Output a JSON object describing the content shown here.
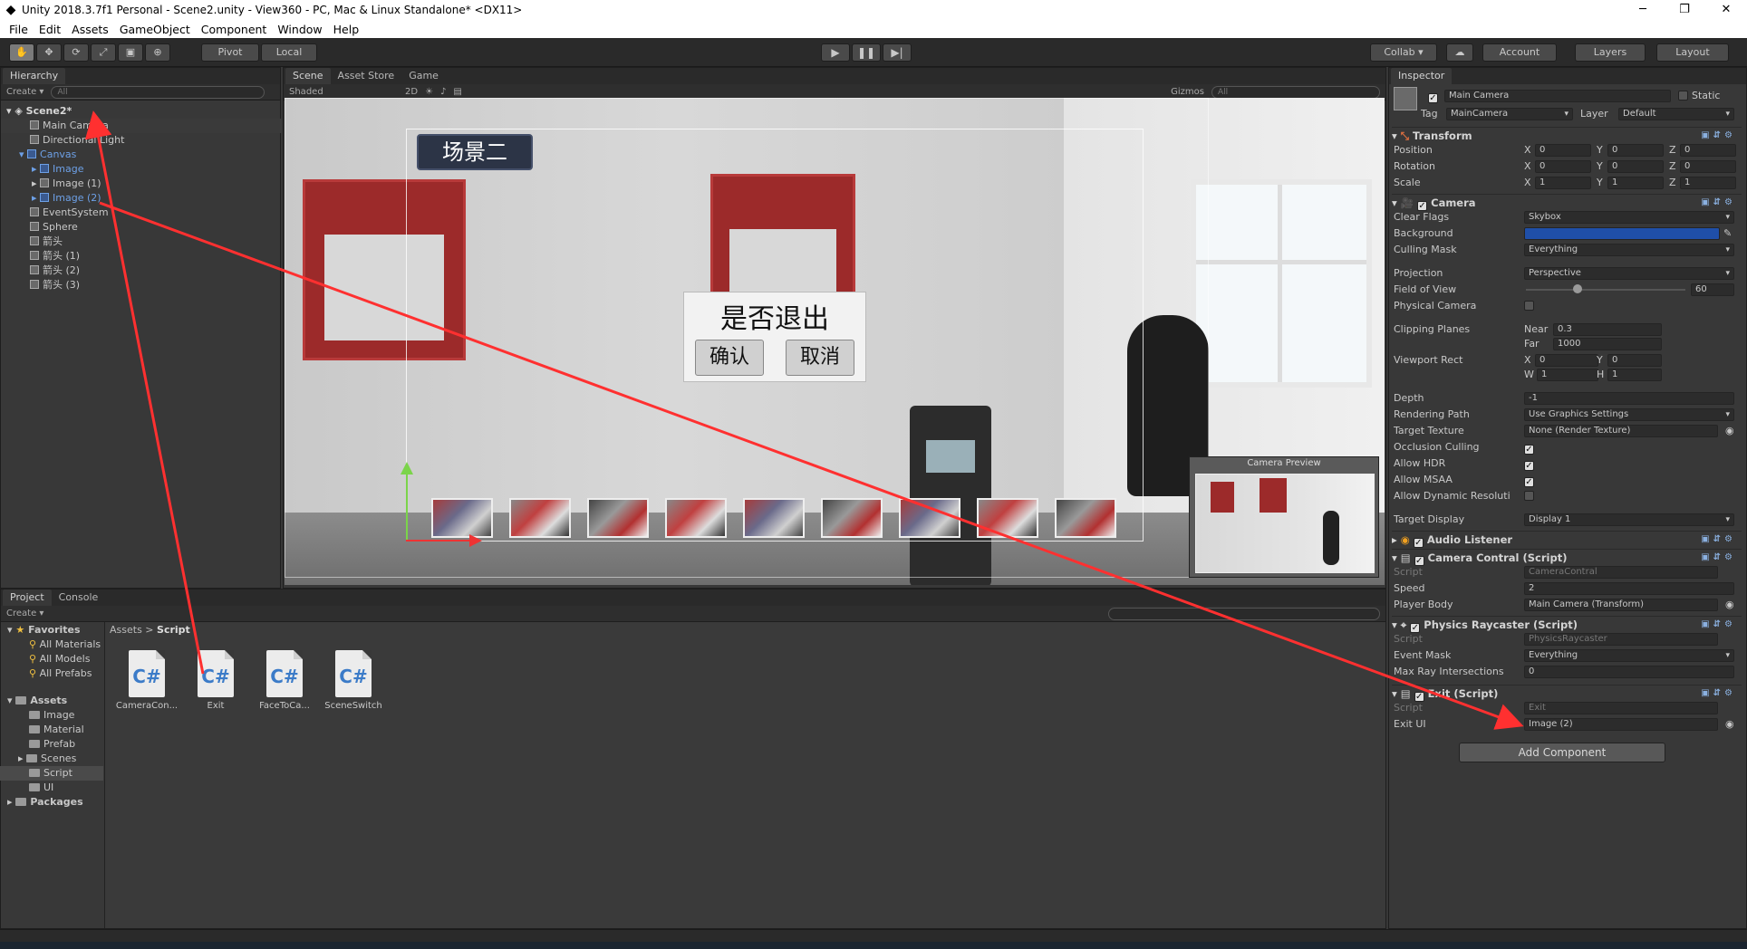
{
  "window": {
    "title": "Unity 2018.3.7f1 Personal - Scene2.unity - View360 - PC, Mac & Linux Standalone* <DX11>",
    "min": "─",
    "max": "❐",
    "close": "✕"
  },
  "menu": [
    "File",
    "Edit",
    "Assets",
    "GameObject",
    "Component",
    "Window",
    "Help"
  ],
  "toolbar": {
    "tools": [
      "✋",
      "✥",
      "⟳",
      "⤢",
      "▣",
      "⊕"
    ],
    "pivot": "Pivot",
    "local": "Local",
    "play": "▶",
    "pause": "❚❚",
    "step": "▶|",
    "collab": "Collab ▾",
    "cloud": "☁",
    "account": "Account",
    "layers": "Layers",
    "layout": "Layout"
  },
  "hierarchy": {
    "tab": "Hierarchy",
    "create": "Create ▾",
    "search": "All",
    "scene": "Scene2*",
    "items": [
      {
        "label": "Main Camera",
        "indent": 1
      },
      {
        "label": "Directional Light",
        "indent": 1
      },
      {
        "label": "Canvas",
        "indent": 1
      },
      {
        "label": "Image",
        "indent": 2
      },
      {
        "label": "Image (1)",
        "indent": 2
      },
      {
        "label": "Image (2)",
        "indent": 2
      },
      {
        "label": "EventSystem",
        "indent": 1
      },
      {
        "label": "Sphere",
        "indent": 1
      },
      {
        "label": "箭头",
        "indent": 1
      },
      {
        "label": "箭头 (1)",
        "indent": 1
      },
      {
        "label": "箭头 (2)",
        "indent": 1
      },
      {
        "label": "箭头 (3)",
        "indent": 1
      }
    ]
  },
  "scene": {
    "tabs": [
      "Scene",
      "Asset Store",
      "Game"
    ],
    "shading": "Shaded",
    "mode2d": "2D",
    "gizmos": "Gizmos",
    "search": "All",
    "title_badge": "场景二",
    "dialog": {
      "question": "是否退出",
      "confirm": "确认",
      "cancel": "取消"
    },
    "camera_preview": "Camera Preview"
  },
  "project": {
    "tabs": [
      "Project",
      "Console"
    ],
    "create": "Create ▾",
    "favorites": {
      "label": "Favorites",
      "items": [
        "All Materials",
        "All Models",
        "All Prefabs"
      ]
    },
    "assets": {
      "label": "Assets",
      "items": [
        "Image",
        "Material",
        "Prefab",
        "Scenes",
        "Script",
        "UI"
      ]
    },
    "packages": "Packages",
    "breadcrumb": [
      "Assets",
      "Script"
    ],
    "files": [
      {
        "name": "CameraCon...",
        "icon": "C#"
      },
      {
        "name": "Exit",
        "icon": "C#"
      },
      {
        "name": "FaceToCa...",
        "icon": "C#"
      },
      {
        "name": "SceneSwitch",
        "icon": "C#"
      }
    ]
  },
  "inspector": {
    "tab": "Inspector",
    "object": {
      "name": "Main Camera",
      "static": "Static",
      "tag_label": "Tag",
      "tag": "MainCamera",
      "layer_label": "Layer",
      "layer": "Default"
    },
    "transform": {
      "title": "Transform",
      "rows": [
        {
          "label": "Position",
          "x": "0",
          "y": "0",
          "z": "0"
        },
        {
          "label": "Rotation",
          "x": "0",
          "y": "0",
          "z": "0"
        },
        {
          "label": "Scale",
          "x": "1",
          "y": "1",
          "z": "1"
        }
      ]
    },
    "camera": {
      "title": "Camera",
      "clear_flags": {
        "label": "Clear Flags",
        "value": "Skybox"
      },
      "background": {
        "label": "Background",
        "color": "#1f4fa8"
      },
      "culling_mask": {
        "label": "Culling Mask",
        "value": "Everything"
      },
      "projection": {
        "label": "Projection",
        "value": "Perspective"
      },
      "fov": {
        "label": "Field of View",
        "value": "60"
      },
      "physical": {
        "label": "Physical Camera"
      },
      "clipping": {
        "label": "Clipping Planes",
        "near_label": "Near",
        "near": "0.3",
        "far_label": "Far",
        "far": "1000"
      },
      "viewport": {
        "label": "Viewport Rect",
        "x": "0",
        "y": "0",
        "w": "1",
        "h": "1"
      },
      "depth": {
        "label": "Depth",
        "value": "-1"
      },
      "rendering_path": {
        "label": "Rendering Path",
        "value": "Use Graphics Settings"
      },
      "target_texture": {
        "label": "Target Texture",
        "value": "None (Render Texture)"
      },
      "occlusion": {
        "label": "Occlusion Culling"
      },
      "hdr": {
        "label": "Allow HDR"
      },
      "msaa": {
        "label": "Allow MSAA"
      },
      "dynres": {
        "label": "Allow Dynamic Resoluti"
      },
      "target_display": {
        "label": "Target Display",
        "value": "Display 1"
      }
    },
    "audio_listener": "Audio Listener",
    "camera_control": {
      "title": "Camera Contral (Script)",
      "script_label": "Script",
      "script": "CameraContral",
      "speed_label": "Speed",
      "speed": "2",
      "body_label": "Player Body",
      "body": "Main Camera (Transform)"
    },
    "physics_raycaster": {
      "title": "Physics Raycaster (Script)",
      "script_label": "Script",
      "script": "PhysicsRaycaster",
      "mask_label": "Event Mask",
      "mask": "Everything",
      "max_label": "Max Ray Intersections",
      "max": "0"
    },
    "exit": {
      "title": "Exit (Script)",
      "script_label": "Script",
      "script": "Exit",
      "ui_label": "Exit UI",
      "ui": "Image (2)"
    },
    "add_component": "Add Component"
  },
  "colors": {
    "arrow": "#ff3030",
    "selection": "#3e5f96",
    "link_blue": "#6da0e6"
  }
}
